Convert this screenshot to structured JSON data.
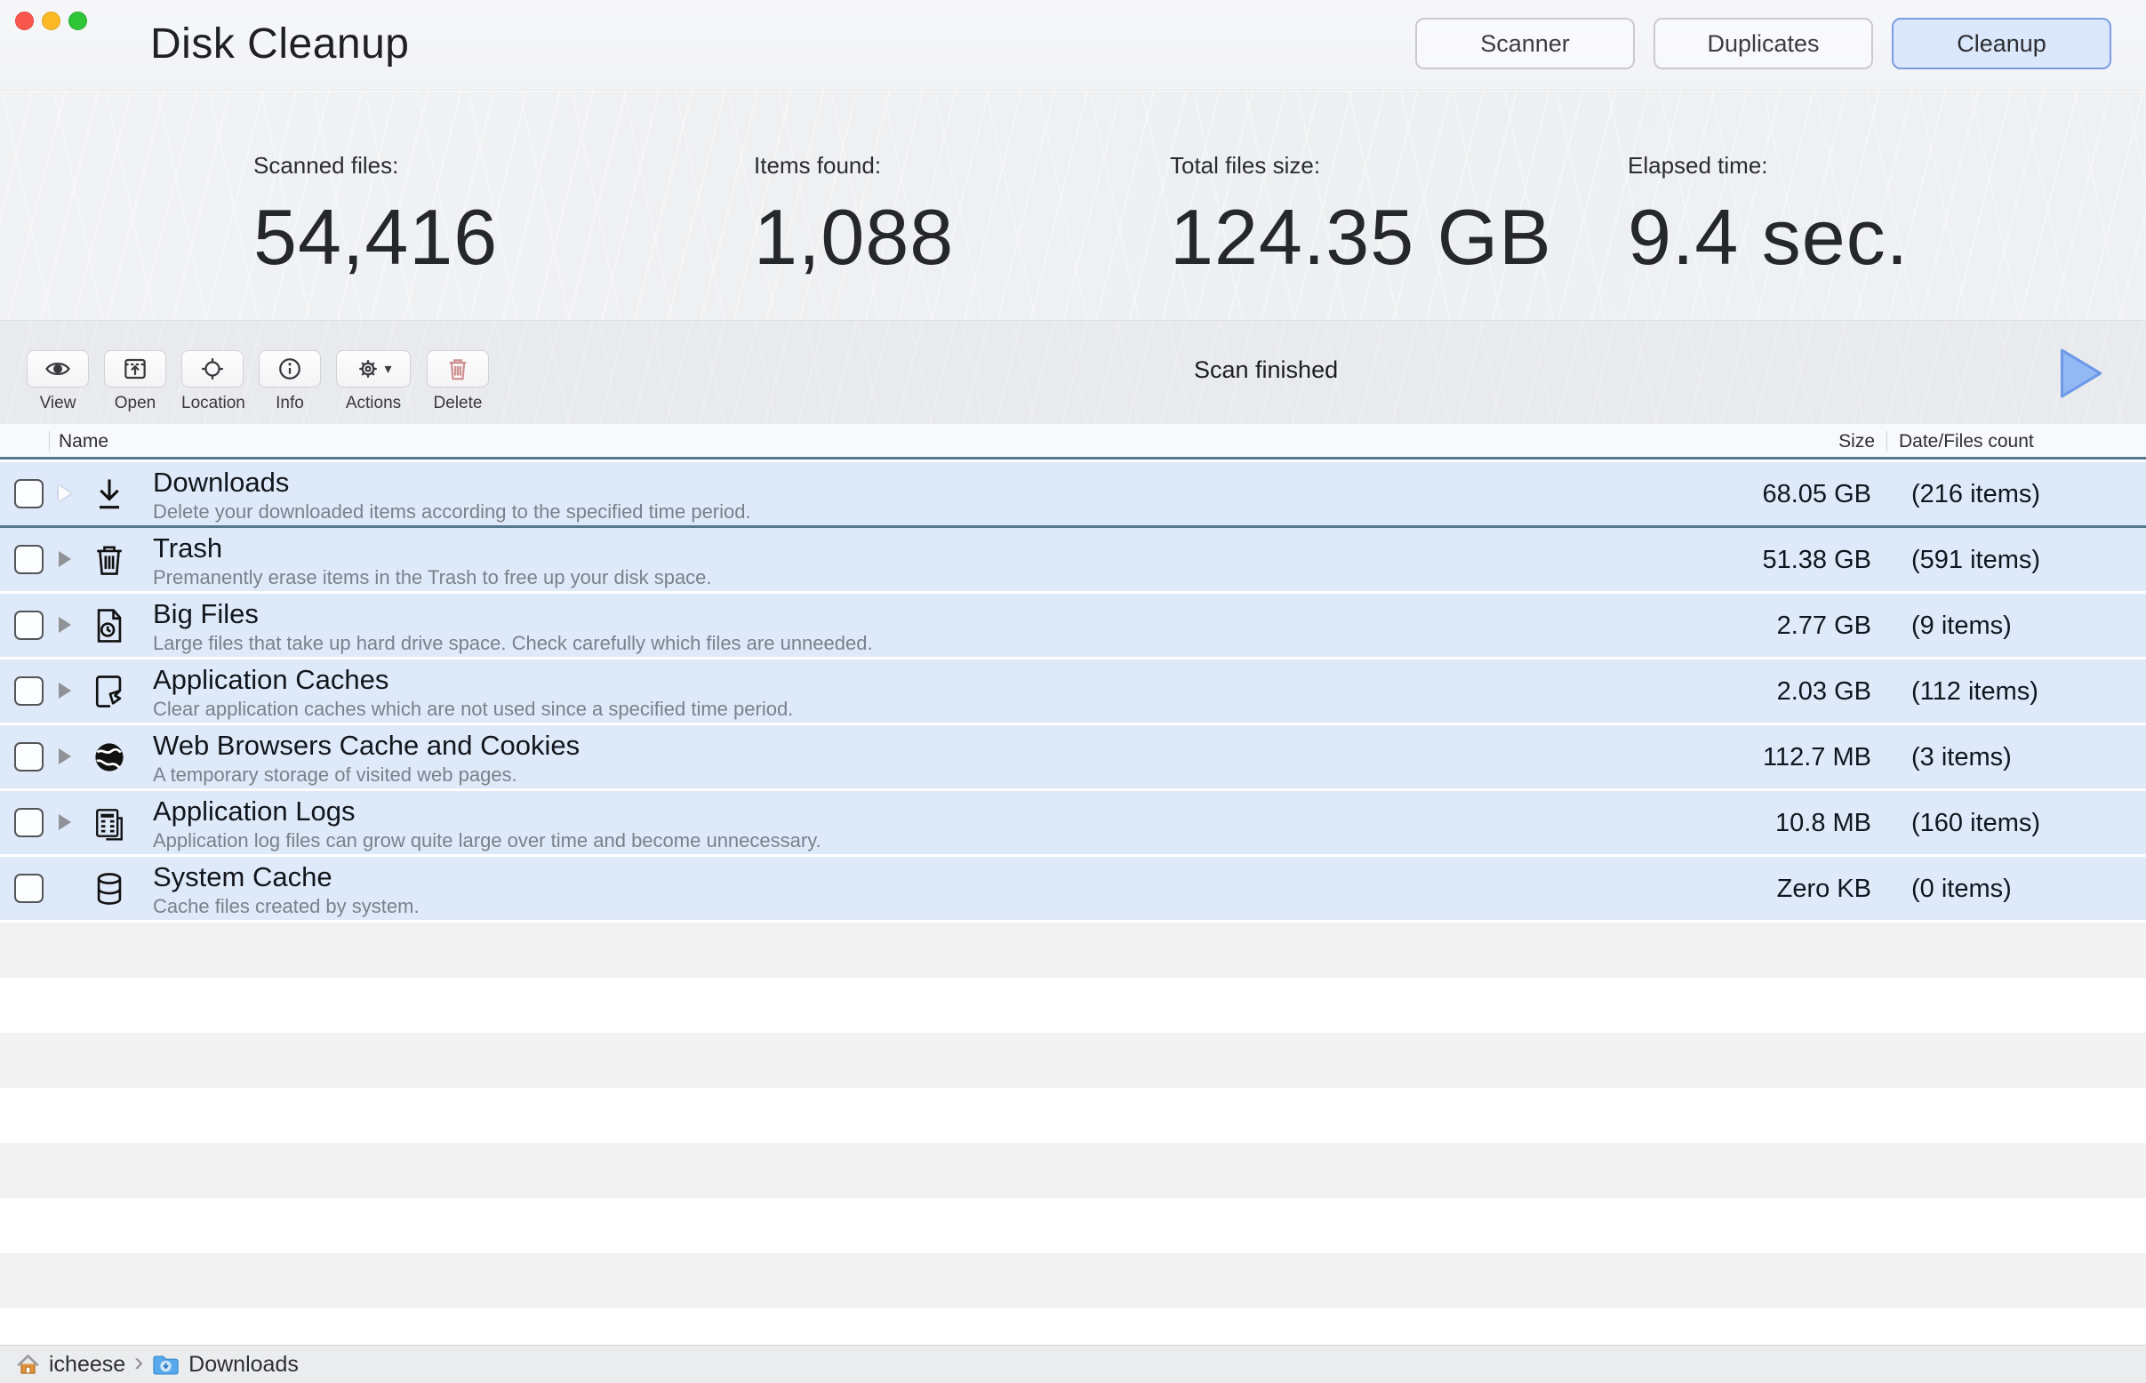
{
  "window": {
    "title": "Disk Cleanup"
  },
  "nav": {
    "buttons": [
      {
        "label": "Scanner",
        "active": false
      },
      {
        "label": "Duplicates",
        "active": false
      },
      {
        "label": "Cleanup",
        "active": true
      }
    ]
  },
  "stats": [
    {
      "label": "Scanned files:",
      "value": "54,416"
    },
    {
      "label": "Items found:",
      "value": "1,088"
    },
    {
      "label": "Total files size:",
      "value": "124.35 GB"
    },
    {
      "label": "Elapsed time:",
      "value": "9.4 sec."
    }
  ],
  "toolbar": {
    "items": [
      {
        "label": "View",
        "icon": "eye-icon"
      },
      {
        "label": "Open",
        "icon": "open-window-icon"
      },
      {
        "label": "Location",
        "icon": "crosshair-icon"
      },
      {
        "label": "Info",
        "icon": "info-icon"
      },
      {
        "label": "Actions",
        "icon": "gear-icon",
        "caret": "▾"
      },
      {
        "label": "Delete",
        "icon": "trash-red-icon"
      }
    ],
    "status": "Scan finished"
  },
  "table": {
    "columns": {
      "name": "Name",
      "size": "Size",
      "count": "Date/Files count"
    },
    "rows": [
      {
        "name": "Downloads",
        "desc": "Delete your downloaded items according to the specified time period.",
        "size": "68.05 GB",
        "count": "(216 items)",
        "icon": "download-icon",
        "selected": true,
        "expandable": true
      },
      {
        "name": "Trash",
        "desc": "Premanently erase items in the Trash to free up your disk space.",
        "size": "51.38 GB",
        "count": "(591 items)",
        "icon": "trash-icon",
        "selected": false,
        "expandable": true
      },
      {
        "name": "Big Files",
        "desc": "Large files that take up hard drive space. Check carefully which files are unneeded.",
        "size": "2.77 GB",
        "count": "(9 items)",
        "icon": "big-file-clock-icon",
        "selected": false,
        "expandable": true
      },
      {
        "name": "Application Caches",
        "desc": "Clear application caches which are not used since a specified time period.",
        "size": "2.03 GB",
        "count": "(112 items)",
        "icon": "app-cache-icon",
        "selected": false,
        "expandable": true
      },
      {
        "name": "Web Browsers Cache and Cookies",
        "desc": "A temporary storage of visited web pages.",
        "size": "112.7 MB",
        "count": "(3 items)",
        "icon": "globe-icon",
        "selected": false,
        "expandable": true
      },
      {
        "name": "Application Logs",
        "desc": "Application log files can grow quite large over time and become unnecessary.",
        "size": "10.8 MB",
        "count": "(160 items)",
        "icon": "logs-icon",
        "selected": false,
        "expandable": true
      },
      {
        "name": "System Cache",
        "desc": "Cache files created by system.",
        "size": "Zero KB",
        "count": "(0 items)",
        "icon": "database-icon",
        "selected": false,
        "expandable": false
      }
    ]
  },
  "statusbar": {
    "crumbs": [
      {
        "label": "icheese",
        "icon": "home-icon"
      },
      {
        "label": "Downloads",
        "icon": "folder-download-icon"
      }
    ],
    "separator": "›"
  },
  "colors": {
    "accent_blue": "#7b9de4",
    "active_button_bg": "#dbe7fb",
    "row_bg": "#dee9f9",
    "selection_border": "#54788e",
    "delete_red": "#cf9090",
    "play_fill": "#93b9f5",
    "stripe_gray": "#f2f2f3"
  }
}
